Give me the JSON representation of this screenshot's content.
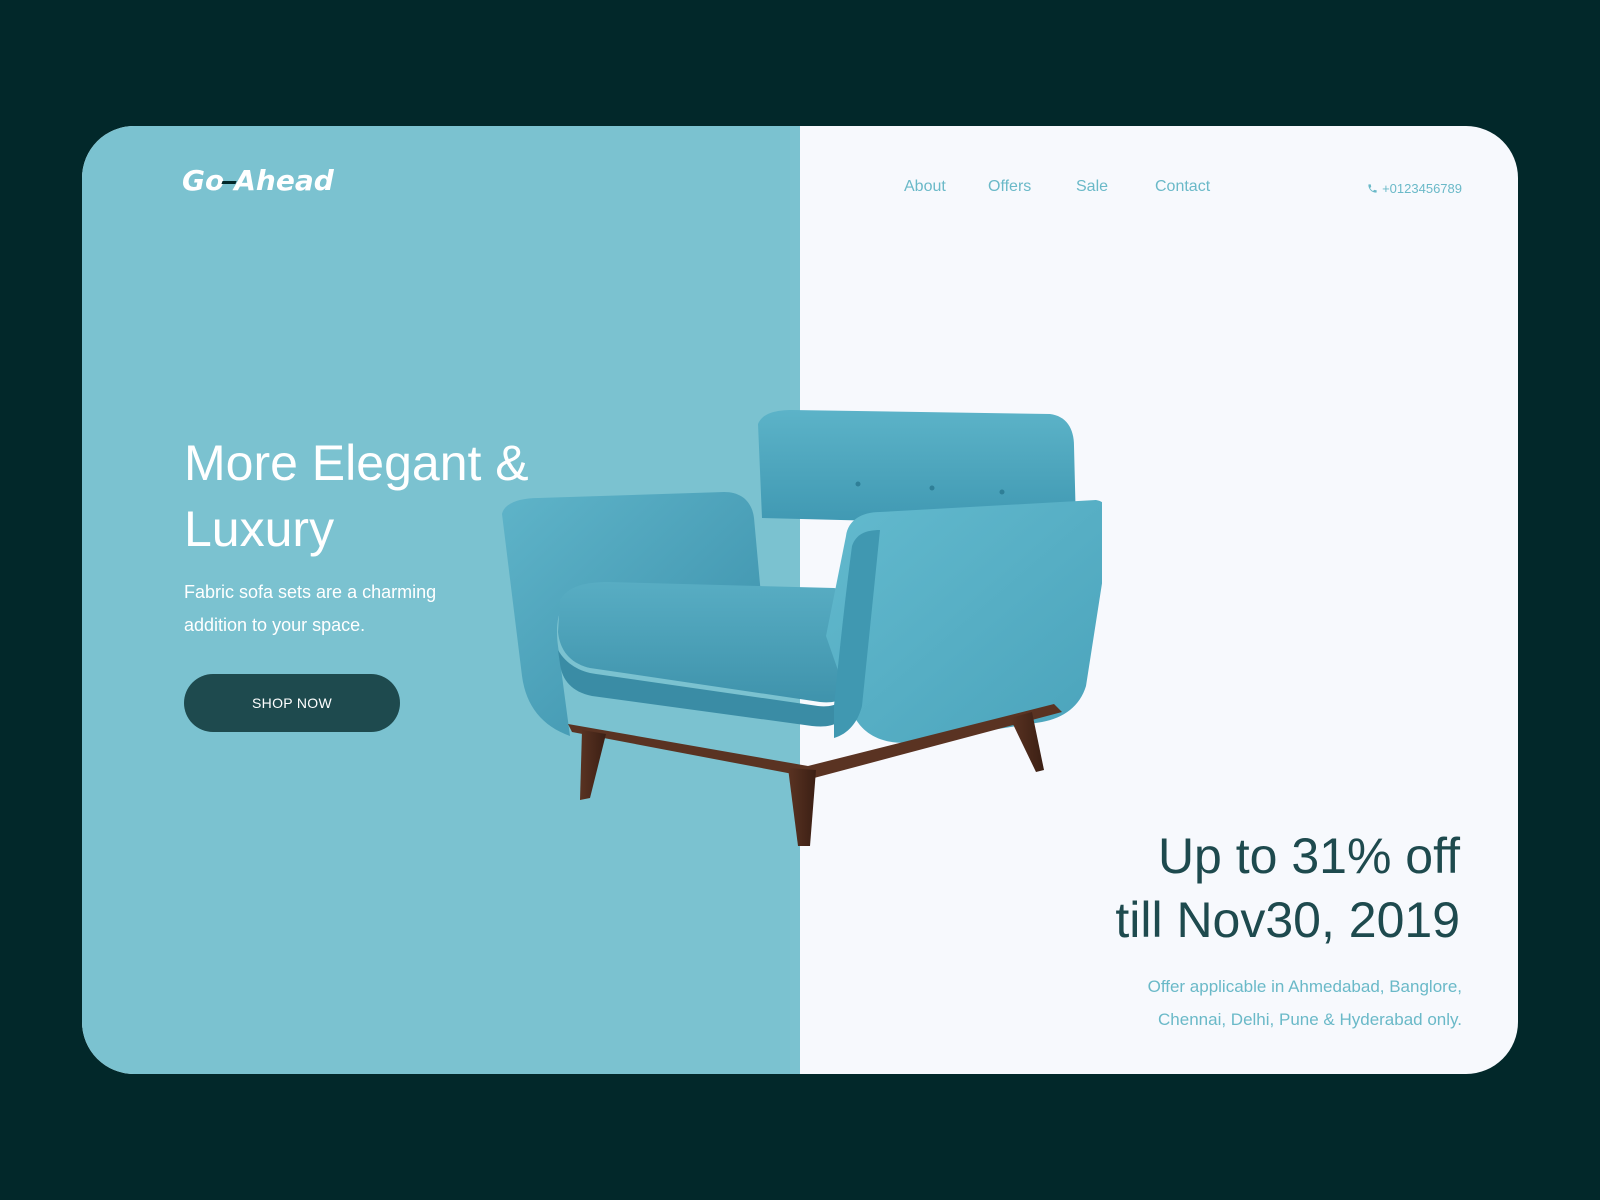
{
  "brand": {
    "logo_part1": "Go",
    "logo_part2": "Ahead"
  },
  "nav": {
    "items": [
      {
        "label": "About"
      },
      {
        "label": "Offers"
      },
      {
        "label": "Sale"
      },
      {
        "label": "Contact"
      }
    ],
    "phone": "+0123456789",
    "phone_icon": "phone-icon"
  },
  "hero": {
    "title_line1": "More Elegant &",
    "title_line2": "Luxury",
    "subtitle": "Fabric sofa sets are a charming addition to your space.",
    "cta_label": "SHOP NOW"
  },
  "offer": {
    "title_line1": "Up to 31% off",
    "title_line2": "till Nov30, 2019",
    "note_line1": "Offer applicable in Ahmedabad, Banglore,",
    "note_line2": "Chennai, Delhi, Pune & Hyderabad only."
  },
  "colors": {
    "background": "#02282a",
    "panel_left": "#7bc2d0",
    "panel_right": "#f7f9fd",
    "accent_dark": "#1e4a4e",
    "accent_light": "#6ab9c8",
    "chair_fabric": "#4fa8c0"
  }
}
